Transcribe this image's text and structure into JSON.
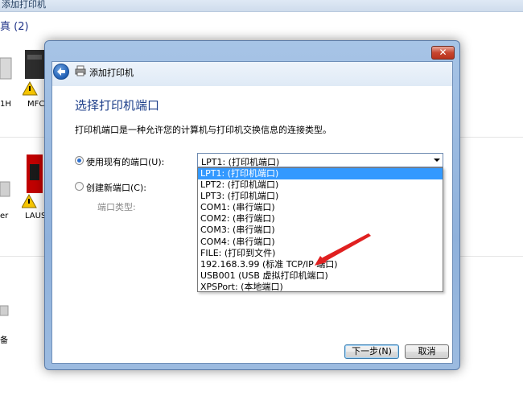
{
  "background": {
    "topbar_title": "添加打印机",
    "group_label": "真 (2)",
    "devices": [
      {
        "label": "1H"
      },
      {
        "label": "MFC"
      },
      {
        "label": "er"
      },
      {
        "label": "LAUS"
      },
      {
        "label": "备"
      }
    ]
  },
  "dialog": {
    "close_label": "✕",
    "header_title": "添加打印机",
    "page_title": "选择打印机端口",
    "description": "打印机端口是一种允许您的计算机与打印机交换信息的连接类型。",
    "use_existing_label": "使用现有的端口(U):",
    "create_new_label": "创建新端口(C):",
    "port_type_label": "端口类型:",
    "selected_port": "LPT1: (打印机端口)",
    "port_options": [
      "LPT1: (打印机端口)",
      "LPT2: (打印机端口)",
      "LPT3: (打印机端口)",
      "COM1: (串行端口)",
      "COM2: (串行端口)",
      "COM3: (串行端口)",
      "COM4: (串行端口)",
      "FILE: (打印到文件)",
      "192.168.3.99 (标准 TCP/IP 端口)",
      "USB001 (USB 虚拟打印机端口)",
      "XPSPort: (本地端口)"
    ],
    "highlighted_index": 0,
    "next_label": "下一步(N)",
    "cancel_label": "取消"
  },
  "colors": {
    "title_blue": "#1e3f8a",
    "highlight": "#3399ff",
    "annotation_arrow": "#e02020"
  }
}
